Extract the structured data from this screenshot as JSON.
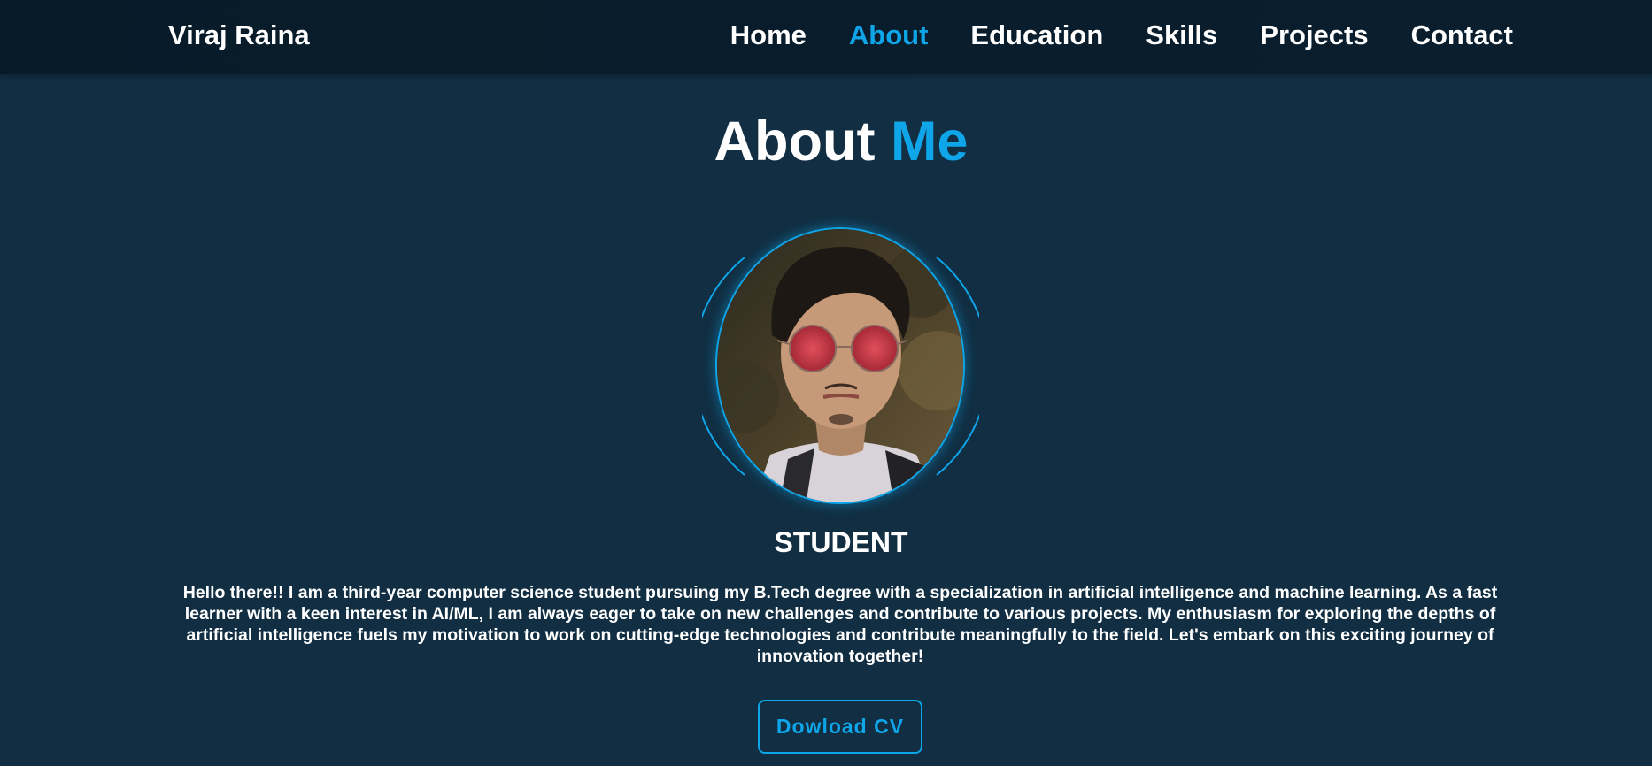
{
  "header": {
    "logo": "Viraj Raina",
    "nav": [
      {
        "label": "Home",
        "active": false
      },
      {
        "label": "About",
        "active": true
      },
      {
        "label": "Education",
        "active": false
      },
      {
        "label": "Skills",
        "active": false
      },
      {
        "label": "Projects",
        "active": false
      },
      {
        "label": "Contact",
        "active": false
      }
    ]
  },
  "about": {
    "title_main": "About",
    "title_accent": "Me",
    "role": "STUDENT",
    "bio": "Hello there!! I am a third-year computer science student pursuing my B.Tech degree with a specialization in artificial intelligence and machine learning. As a fast learner with a keen interest in AI/ML, I am always eager to take on new challenges and contribute to various projects. My enthusiasm for exploring the depths of artificial intelligence fuels my motivation to work on cutting-edge technologies and contribute meaningfully to the field. Let's embark on this exciting journey of innovation together!",
    "cta_label": "Dowload CV"
  },
  "colors": {
    "background": "#112e42",
    "header_background": "#081b29",
    "accent": "#0ea5e9",
    "text": "#ffffff"
  }
}
